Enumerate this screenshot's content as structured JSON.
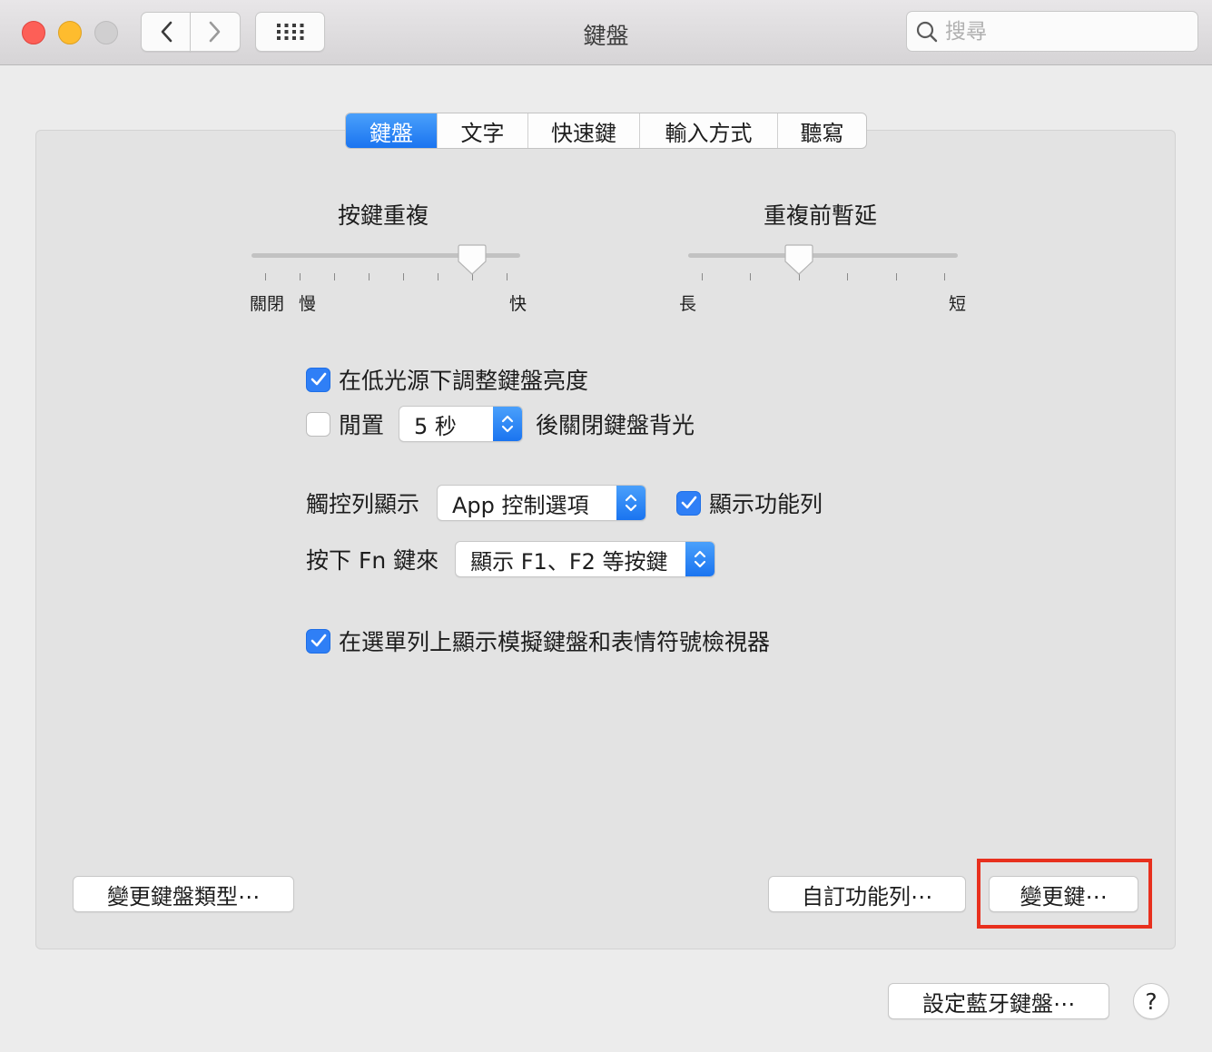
{
  "window": {
    "title": "鍵盤"
  },
  "toolbar": {
    "search_placeholder": "搜尋"
  },
  "tabs": [
    {
      "label": "鍵盤",
      "active": true
    },
    {
      "label": "文字",
      "active": false
    },
    {
      "label": "快速鍵",
      "active": false
    },
    {
      "label": "輸入方式",
      "active": false
    },
    {
      "label": "聽寫",
      "active": false
    }
  ],
  "key_repeat": {
    "title": "按鍵重複",
    "label_off": "關閉",
    "label_slow": "慢",
    "label_fast": "快",
    "value_step": 6,
    "steps": 8
  },
  "delay_until_repeat": {
    "title": "重複前暫延",
    "label_long": "長",
    "label_short": "短",
    "value_step": 2,
    "steps": 6
  },
  "backlight": {
    "adjust_label": "在低光源下調整鍵盤亮度",
    "adjust_checked": true,
    "idle_prefix": "閒置",
    "idle_checked": false,
    "idle_value": "5 秒",
    "idle_suffix": "後關閉鍵盤背光"
  },
  "touchbar": {
    "label": "觸控列顯示",
    "value": "App 控制選項",
    "show_control_strip_label": "顯示功能列",
    "show_control_strip_checked": true
  },
  "fn_key": {
    "label": "按下 Fn 鍵來",
    "value": "顯示 F1、F2 等按鍵"
  },
  "menu_bar_viewer": {
    "label": "在選單列上顯示模擬鍵盤和表情符號檢視器",
    "checked": true
  },
  "buttons": {
    "change_keyboard_type": "變更鍵盤類型⋯",
    "customize_control_strip": "自訂功能列⋯",
    "modifier_keys": "變更鍵⋯",
    "setup_bluetooth": "設定藍牙鍵盤⋯",
    "help": "?"
  },
  "colors": {
    "accent": "#2f7ff6",
    "highlight_box": "#e8301e"
  }
}
